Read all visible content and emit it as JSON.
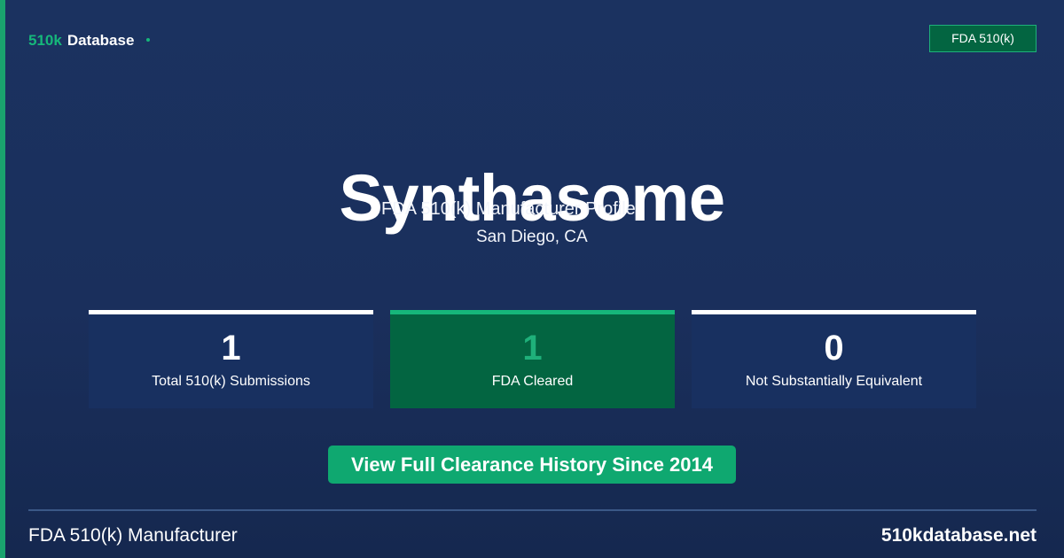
{
  "brand": {
    "accent": "510k",
    "name": "Database",
    "accent_color": "#16b77a"
  },
  "badge": {
    "label": "FDA 510(k)"
  },
  "manufacturer": {
    "name": "Synthasome",
    "subtitle": "FDA 510(k) Manufacturer Profile",
    "location": "San Diego, CA"
  },
  "stats": [
    {
      "value": "1",
      "label": "Total 510(k) Submissions"
    },
    {
      "value": "1",
      "label": "FDA Cleared"
    },
    {
      "value": "0",
      "label": "Not Substantially Equivalent"
    }
  ],
  "cta": {
    "label": "View Full Clearance History Since 2014"
  },
  "footer": {
    "left": "FDA 510(k) Manufacturer",
    "right": "510kdatabase.net"
  },
  "colors": {
    "background": "#1b3260",
    "accent_green": "#16b77a",
    "stat_green": "#036541",
    "stat_blue": "#183060"
  }
}
